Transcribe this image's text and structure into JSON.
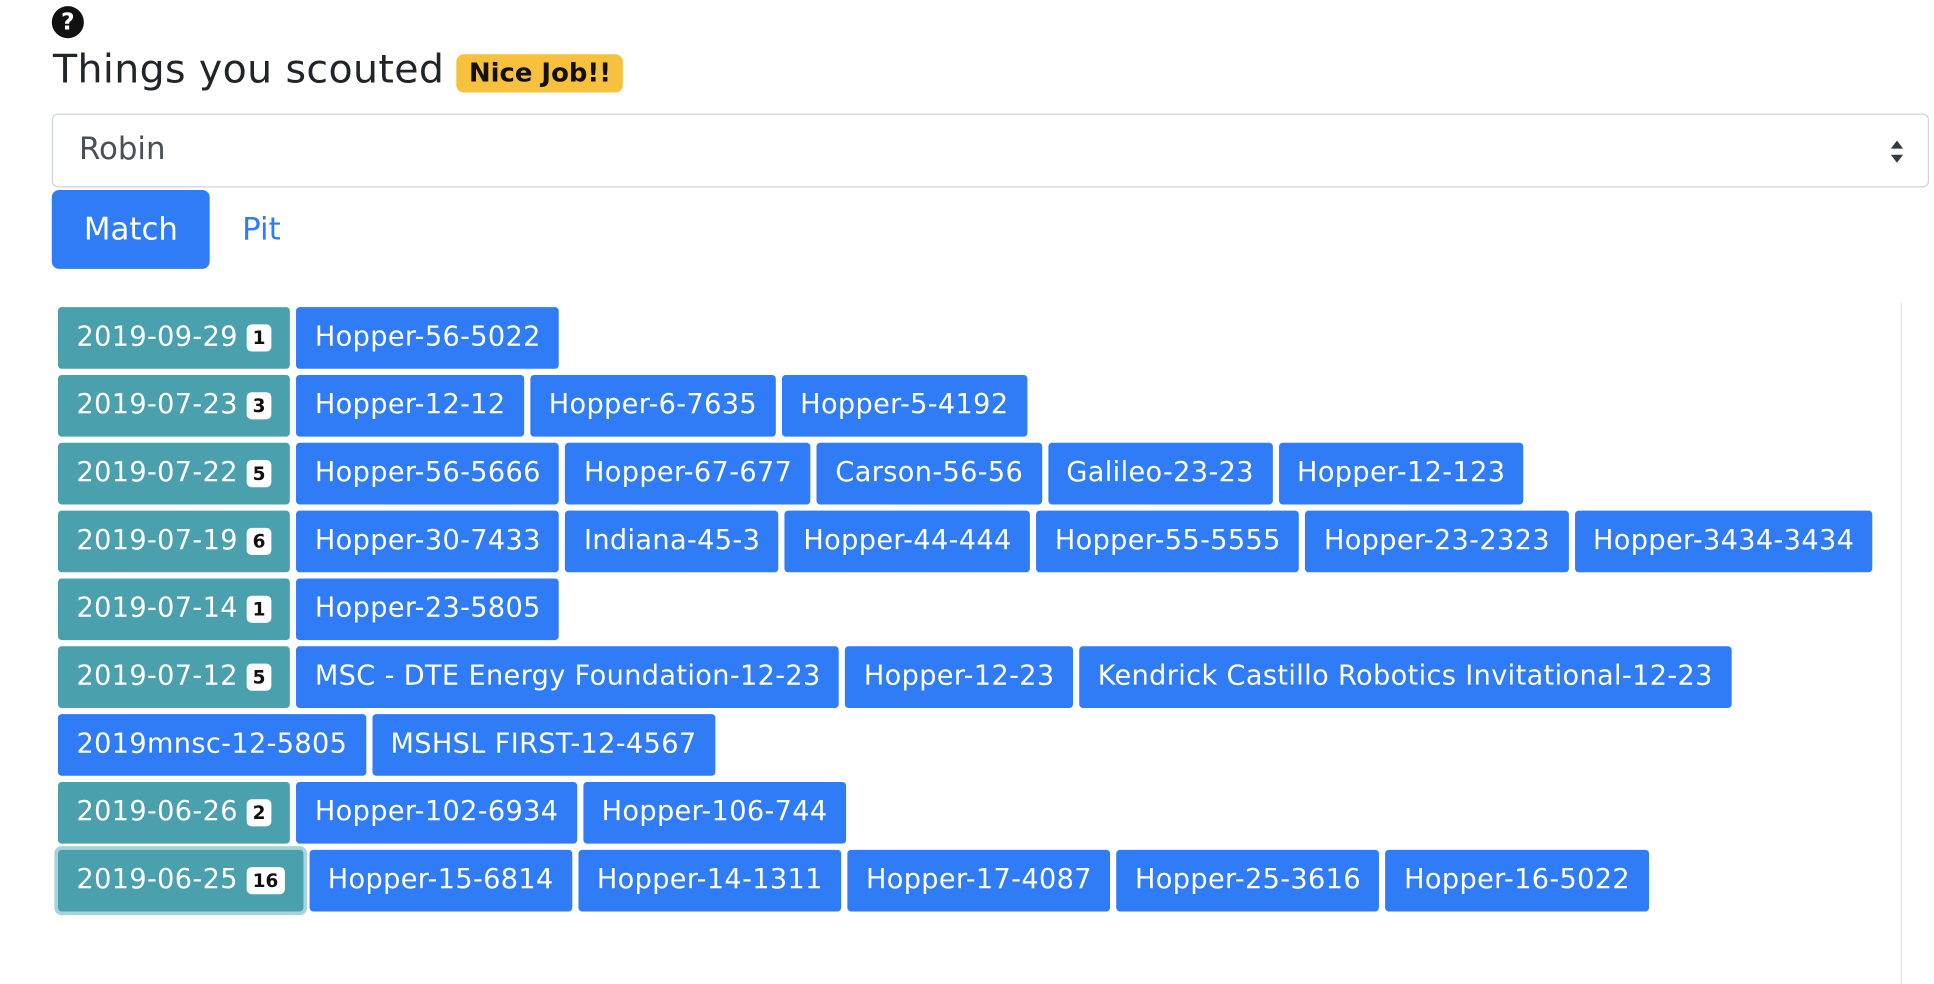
{
  "help": {
    "glyph": "?",
    "icon": "question-circle-icon"
  },
  "header": {
    "title": "Things you scouted",
    "badge": "Nice Job!!"
  },
  "scout_select": {
    "value": "Robin"
  },
  "tabs": [
    {
      "label": "Match",
      "active": true
    },
    {
      "label": "Pit",
      "active": false
    }
  ],
  "dates": [
    {
      "date": "2019-09-29",
      "count": "1",
      "matches": [
        "Hopper-56-5022"
      ]
    },
    {
      "date": "2019-07-23",
      "count": "3",
      "matches": [
        "Hopper-12-12",
        "Hopper-6-7635",
        "Hopper-5-4192"
      ]
    },
    {
      "date": "2019-07-22",
      "count": "5",
      "matches": [
        "Hopper-56-5666",
        "Hopper-67-677",
        "Carson-56-56",
        "Galileo-23-23",
        "Hopper-12-123"
      ]
    },
    {
      "date": "2019-07-19",
      "count": "6",
      "matches": [
        "Hopper-30-7433",
        "Indiana-45-3",
        "Hopper-44-444",
        "Hopper-55-5555",
        "Hopper-23-2323",
        "Hopper-3434-3434"
      ]
    },
    {
      "date": "2019-07-14",
      "count": "1",
      "matches": [
        "Hopper-23-5805"
      ]
    },
    {
      "date": "2019-07-12",
      "count": "5",
      "matches": [
        "MSC - DTE Energy Foundation-12-23",
        "Hopper-12-23",
        "Kendrick Castillo Robotics Invitational-12-23",
        "2019mnsc-12-5805",
        "MSHSL FIRST-12-4567"
      ]
    },
    {
      "date": "2019-06-26",
      "count": "2",
      "matches": [
        "Hopper-102-6934",
        "Hopper-106-744"
      ]
    },
    {
      "date": "2019-06-25",
      "count": "16",
      "focused": true,
      "matches": [
        "Hopper-15-6814",
        "Hopper-14-1311",
        "Hopper-17-4087",
        "Hopper-25-3616",
        "Hopper-16-5022"
      ]
    }
  ],
  "colors": {
    "primary": "#2f7cf6",
    "date_chip": "#4ba0ad",
    "badge_warning": "#f7c03d"
  }
}
